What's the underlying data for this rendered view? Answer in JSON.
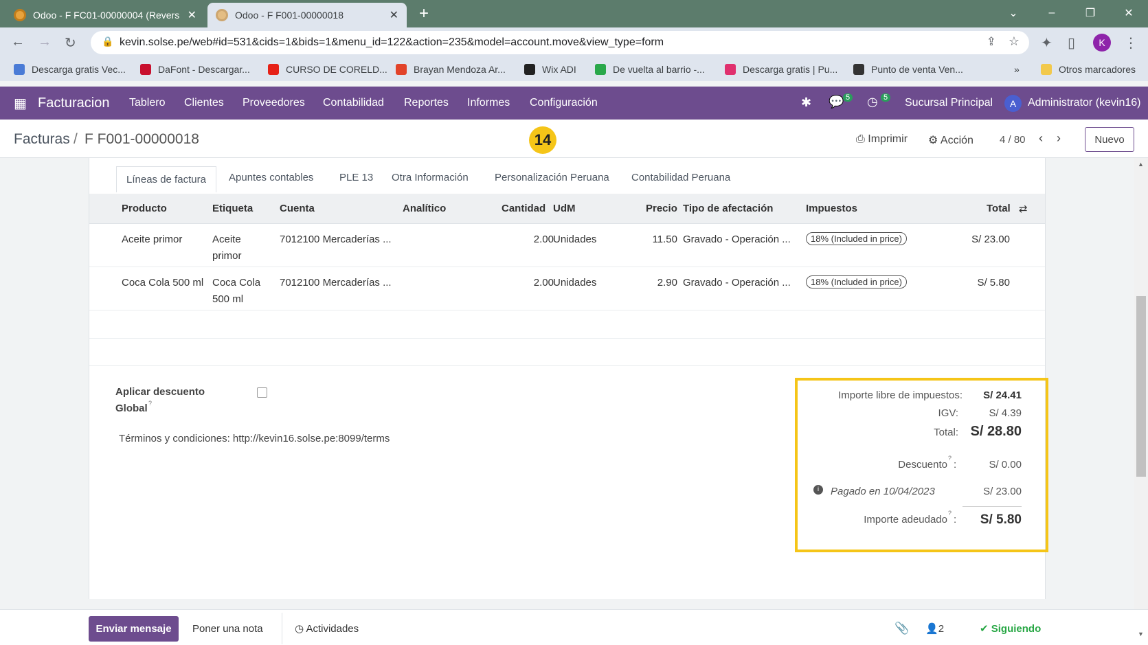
{
  "browser": {
    "tabs": [
      {
        "title": "Odoo - F FC01-00000004 (Revers"
      },
      {
        "title": "Odoo - F F001-00000018"
      }
    ],
    "url": "kevin.solse.pe/web#id=531&cids=1&bids=1&menu_id=122&action=235&model=account.move&view_type=form",
    "profile": "K",
    "bookmarks": [
      {
        "label": "Descarga gratis Vec...",
        "color": "#4a7bd6"
      },
      {
        "label": "DaFont - Descargar...",
        "color": "#c8102e"
      },
      {
        "label": "CURSO DE CORELD...",
        "color": "#e62117"
      },
      {
        "label": "Brayan Mendoza Ar...",
        "color": "#e24329"
      },
      {
        "label": "Wix ADI",
        "color": "#222222"
      },
      {
        "label": "De vuelta al barrio -...",
        "color": "#2aa84a"
      },
      {
        "label": "Descarga gratis | Pu...",
        "color": "#e0306e"
      },
      {
        "label": "Punto de venta Ven...",
        "color": "#333333"
      }
    ],
    "other_bookmarks": "Otros marcadores"
  },
  "odoo_nav": {
    "app": "Facturacion",
    "menus": [
      "Tablero",
      "Clientes",
      "Proveedores",
      "Contabilidad",
      "Reportes",
      "Informes",
      "Configuración"
    ],
    "messages_count": "5",
    "activities_count": "5",
    "branch": "Sucursal Principal",
    "user_initial": "A",
    "user": "Administrator (kevin16)"
  },
  "control_panel": {
    "breadcrumb_root": "Facturas",
    "breadcrumb_sep": "/",
    "breadcrumb_current": "F F001-00000018",
    "step_badge": "14",
    "print": "Imprimir",
    "action": "Acción",
    "pager": "4 / 80",
    "new": "Nuevo"
  },
  "form": {
    "tabs": [
      "Líneas de factura",
      "Apuntes contables",
      "PLE 13",
      "Otra Información",
      "Personalización Peruana",
      "Contabilidad Peruana"
    ],
    "columns": {
      "product": "Producto",
      "label": "Etiqueta",
      "account": "Cuenta",
      "analytic": "Analítico",
      "qty": "Cantidad",
      "uom": "UdM",
      "price": "Precio",
      "affect": "Tipo de afectación",
      "taxes": "Impuestos",
      "total": "Total"
    },
    "lines": [
      {
        "product": "Aceite primor",
        "label1": "Aceite",
        "label2": "primor",
        "account": "7012100 Mercaderías ...",
        "qty": "2.00",
        "uom": "Unidades",
        "price": "11.50",
        "affect": "Gravado - Operación ...",
        "tax": "18% (Included in price)",
        "total": "S/ 23.00"
      },
      {
        "product": "Coca Cola 500 ml",
        "label1": "Coca Cola",
        "label2": "500 ml",
        "account": "7012100 Mercaderías ...",
        "qty": "2.00",
        "uom": "Unidades",
        "price": "2.90",
        "affect": "Gravado - Operación ...",
        "tax": "18% (Included in price)",
        "total": "S/ 5.80"
      }
    ],
    "global_discount_1": "Aplicar descuento",
    "global_discount_2": "Global",
    "terms": "Términos y condiciones: http://kevin16.solse.pe:8099/terms",
    "totals": {
      "untaxed_label": "Importe libre de impuestos:",
      "untaxed": "S/ 24.41",
      "igv_label": "IGV:",
      "igv": "S/ 4.39",
      "total_label": "Total:",
      "total": "S/ 28.80",
      "discount_label": "Descuento",
      "discount": "S/ 0.00",
      "paid_label": "Pagado en 10/04/2023",
      "paid": "S/ 23.00",
      "due_label": "Importe adeudado",
      "due": "S/ 5.80"
    }
  },
  "chatter": {
    "send": "Enviar mensaje",
    "note": "Poner una nota",
    "activities": "Actividades",
    "followers": "2",
    "following": "Siguiendo"
  },
  "colors": {
    "odoo_purple": "#6d4c8e",
    "highlight": "#f5c518",
    "following": "#28a745"
  }
}
